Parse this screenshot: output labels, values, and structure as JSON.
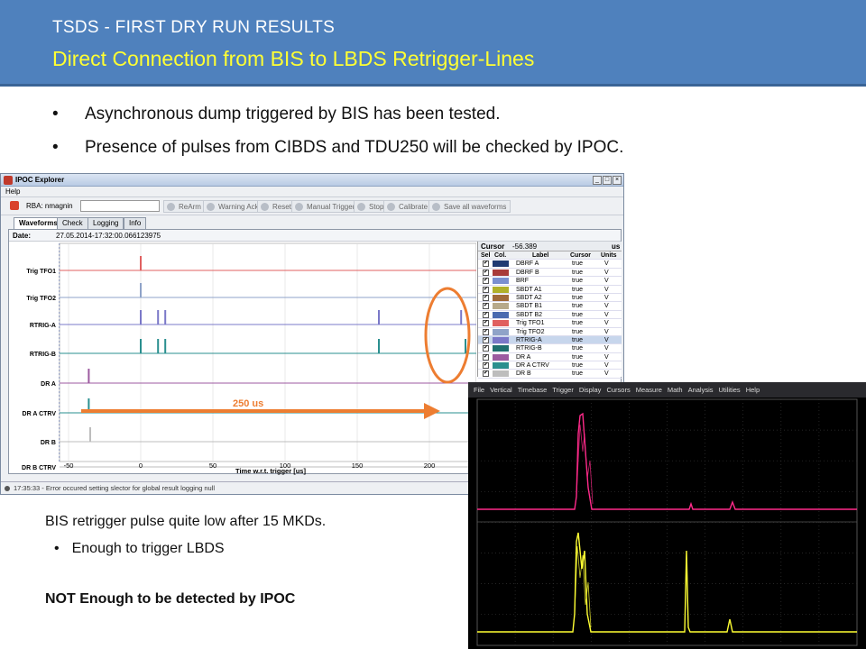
{
  "slide": {
    "title": "TSDS - FIRST DRY RUN RESULTS",
    "subtitle": "Direct Connection from BIS to LBDS Retrigger-Lines",
    "bullets": [
      "Asynchronous dump triggered by BIS has been tested.",
      "Presence of pulses from CIBDS and TDU250 will be checked by IPOC."
    ],
    "note_main": "BIS retrigger pulse quite low after 15 MKDs.",
    "note_sub": "Enough to trigger LBDS",
    "note_bold": "NOT Enough to be detected by IPOC",
    "annotation": "250 us",
    "colors": {
      "header_bg": "#4f81bd",
      "subtitle": "#ffff33",
      "annotation": "#ed7d31",
      "arrow": "#ed7d31"
    }
  },
  "ipoc": {
    "title": "IPOC Explorer",
    "menu": "Help",
    "rba_label": "RBA: nmagnin",
    "buttons": [
      "ReArm",
      "Warning Ack",
      "Reset",
      "Manual Trigger",
      "Stop",
      "Calibrate",
      "Save all waveforms"
    ],
    "tabs": [
      "Waveforms",
      "Check",
      "Logging",
      "Info"
    ],
    "date_label": "Date:",
    "date_value": "27.05.2014-17:32:00.066123975",
    "channels": [
      "Trig TFO1",
      "Trig TFO2",
      "RTRIG-A",
      "RTRIG-B",
      "DR A",
      "DR A CTRV",
      "DR B",
      "DR B CTRV"
    ],
    "x_ticks": [
      "-50",
      "0",
      "50",
      "100",
      "150",
      "200"
    ],
    "x_label": "Time w.r.t. trigger [us]",
    "cursor_label": "Cursor",
    "cursor_value": "-56.389",
    "cursor_unit": "us",
    "table_headers": [
      "Sel",
      "Col.",
      "Label",
      "Cursor",
      "Units"
    ],
    "table_rows": [
      {
        "label": "DBRF A",
        "cursor": "true",
        "unit": "V",
        "color": "#1f3b73"
      },
      {
        "label": "DBRF B",
        "cursor": "true",
        "unit": "V",
        "color": "#a83a3a"
      },
      {
        "label": "BRF",
        "cursor": "true",
        "unit": "V",
        "color": "#7a8fd0"
      },
      {
        "label": "SBDT A1",
        "cursor": "true",
        "unit": "V",
        "color": "#b0b02a"
      },
      {
        "label": "SBDT A2",
        "cursor": "true",
        "unit": "V",
        "color": "#a06a3a"
      },
      {
        "label": "SBDT B1",
        "cursor": "true",
        "unit": "V",
        "color": "#b7a98a"
      },
      {
        "label": "SBDT B2",
        "cursor": "true",
        "unit": "V",
        "color": "#4a6ab0"
      },
      {
        "label": "Trig TFO1",
        "cursor": "true",
        "unit": "V",
        "color": "#e06060"
      },
      {
        "label": "Trig TFO2",
        "cursor": "true",
        "unit": "V",
        "color": "#8fa3c8"
      },
      {
        "label": "RTRIG-A",
        "cursor": "true",
        "unit": "V",
        "color": "#7a78c8"
      },
      {
        "label": "RTRIG-B",
        "cursor": "true",
        "unit": "V",
        "color": "#1f6f6f"
      },
      {
        "label": "DR A",
        "cursor": "true",
        "unit": "V",
        "color": "#9c5aa0"
      },
      {
        "label": "DR A CTRV",
        "cursor": "true",
        "unit": "V",
        "color": "#2a8f8f"
      },
      {
        "label": "DR B",
        "cursor": "true",
        "unit": "V",
        "color": "#bdbdbd"
      }
    ],
    "status": "17:35:33 - Error occured setting slector for global result logging null"
  },
  "scope": {
    "menu": [
      "File",
      "Vertical",
      "Timebase",
      "Trigger",
      "Display",
      "Cursors",
      "Measure",
      "Math",
      "Analysis",
      "Utilities",
      "Help"
    ],
    "colors": {
      "trace1": "#ff2a8a",
      "trace2": "#ffff33"
    }
  }
}
